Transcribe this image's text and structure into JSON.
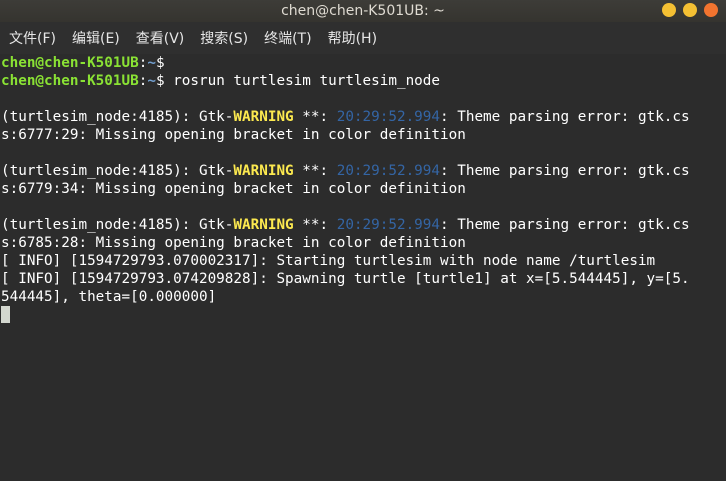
{
  "window": {
    "title": "chen@chen-K501UB: ~"
  },
  "menu": [
    {
      "label": "文件(F)"
    },
    {
      "label": "编辑(E)"
    },
    {
      "label": "查看(V)"
    },
    {
      "label": "搜索(S)"
    },
    {
      "label": "终端(T)"
    },
    {
      "label": "帮助(H)"
    }
  ],
  "colors": {
    "prompt_user": "#8ae234",
    "prompt_path": "#729fcf",
    "warning": "#fce94f",
    "timestamp": "#3465a4",
    "background": "#2c2c2c"
  },
  "terminal": {
    "prompt1": {
      "user": "chen@chen-K501UB",
      "colon": ":",
      "path": "~",
      "sym": "$",
      "cmd": ""
    },
    "prompt2": {
      "user": "chen@chen-K501UB",
      "colon": ":",
      "path": "~",
      "sym": "$ ",
      "cmd": "rosrun turtlesim turtlesim_node"
    },
    "warnings": [
      {
        "pre": "(turtlesim_node:4185): Gtk-",
        "level": "WARNING",
        "mid": " **: ",
        "time": "20:29:52.994",
        "post": ": Theme parsing error: gtk.cs",
        "cont": "s:6777:29: Missing opening bracket in color definition"
      },
      {
        "pre": "(turtlesim_node:4185): Gtk-",
        "level": "WARNING",
        "mid": " **: ",
        "time": "20:29:52.994",
        "post": ": Theme parsing error: gtk.cs",
        "cont": "s:6779:34: Missing opening bracket in color definition"
      },
      {
        "pre": "(turtlesim_node:4185): Gtk-",
        "level": "WARNING",
        "mid": " **: ",
        "time": "20:29:52.994",
        "post": ": Theme parsing error: gtk.cs",
        "cont": "s:6785:28: Missing opening bracket in color definition"
      }
    ],
    "info1": "[ INFO] [1594729793.070002317]: Starting turtlesim with node name /turtlesim",
    "info2a": "[ INFO] [1594729793.074209828]: Spawning turtle [turtle1] at x=[5.544445], y=[5.",
    "info2b": "544445], theta=[0.000000]"
  }
}
